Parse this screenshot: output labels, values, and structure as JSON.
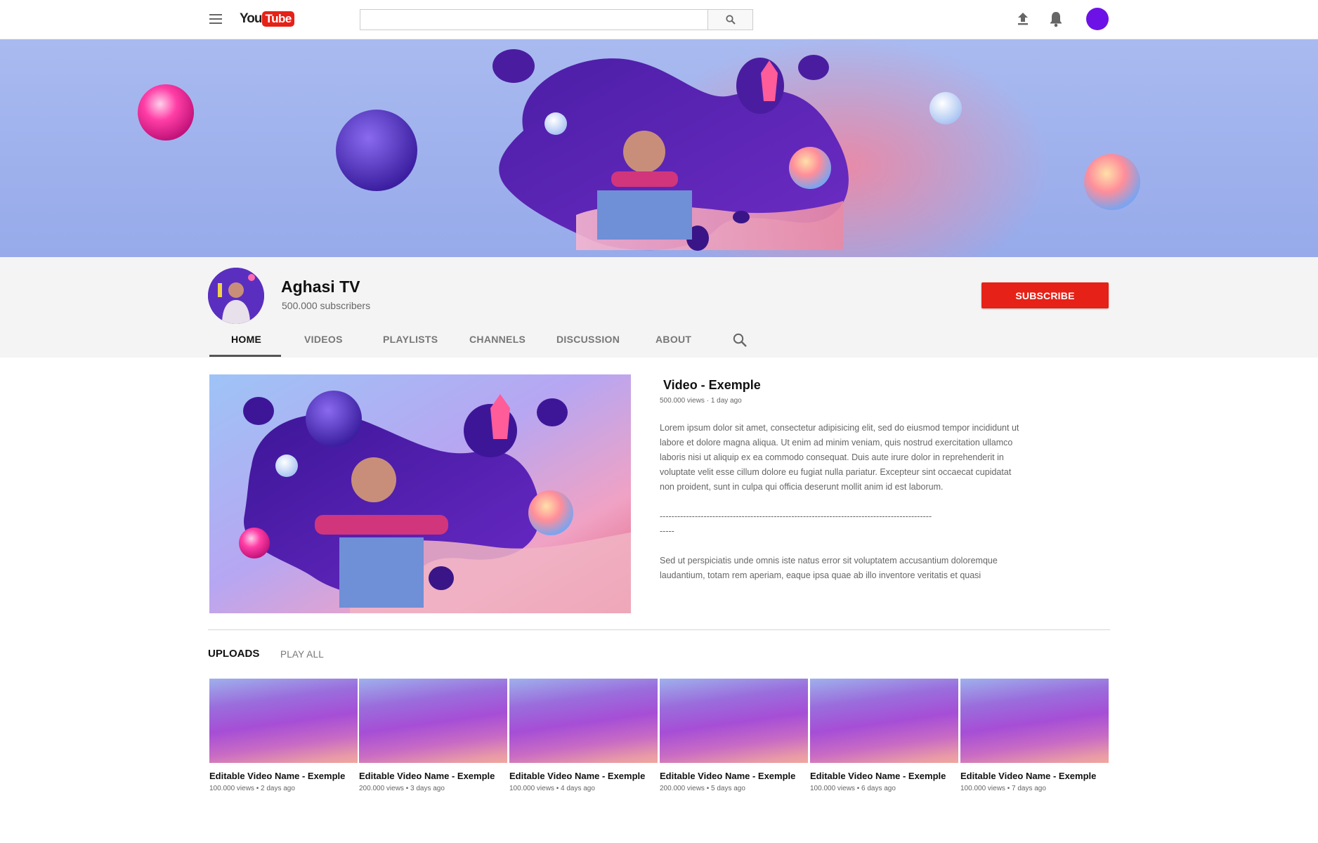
{
  "header": {
    "logo_you": "You",
    "logo_tube": "Tube",
    "search_placeholder": "",
    "avatar_color": "#6d12e6"
  },
  "channel": {
    "name": "Aghasi TV",
    "subscribers": "500.000 subscribers",
    "subscribe_label": "SUBSCRIBE",
    "accent_color": "#e62117"
  },
  "tabs": [
    {
      "label": "HOME",
      "active": true
    },
    {
      "label": "VIDEOS",
      "active": false
    },
    {
      "label": "PLAYLISTS",
      "active": false
    },
    {
      "label": "CHANNELS",
      "active": false
    },
    {
      "label": "DISCUSSION",
      "active": false
    },
    {
      "label": "ABOUT",
      "active": false
    }
  ],
  "featured": {
    "title": "Video - Exemple",
    "meta": "500.000 views · 1 day ago",
    "description": "Lorem ipsum dolor sit amet, consectetur adipisicing elit, sed do eiusmod tempor incididunt ut labore et dolore magna aliqua. Ut enim ad minim veniam, quis nostrud exercitation ullamco laboris nisi ut aliquip ex ea commodo consequat. Duis aute irure dolor in reprehenderit in voluptate velit esse cillum dolore eu fugiat nulla pariatur. Excepteur sint occaecat cupidatat non proident, sunt in culpa qui officia deserunt mollit anim id est laborum.\n\n---------------------------------------------------------------------------------------------\n-----\n\nSed ut perspiciatis unde omnis iste natus error sit voluptatem accusantium doloremque laudantium, totam rem aperiam, eaque ipsa quae ab illo inventore veritatis et quasi"
  },
  "uploads": {
    "label": "UPLOADS",
    "play_all": "PLAY ALL",
    "videos": [
      {
        "title": "Editable Video Name - Exemple",
        "meta": "100.000 views • 2 days ago"
      },
      {
        "title": "Editable Video Name - Exemple",
        "meta": "200.000 views • 3 days ago"
      },
      {
        "title": "Editable Video Name - Exemple",
        "meta": "100.000 views • 4 days ago"
      },
      {
        "title": "Editable Video Name - Exemple",
        "meta": "200.000 views • 5 days ago"
      },
      {
        "title": "Editable Video Name - Exemple",
        "meta": "100.000 views • 6 days ago"
      },
      {
        "title": "Editable Video Name - Exemple",
        "meta": "100.000 views • 7 days ago"
      }
    ]
  }
}
